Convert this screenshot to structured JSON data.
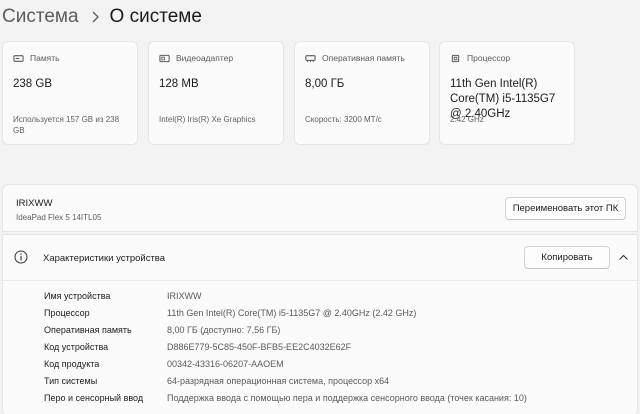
{
  "breadcrumb": {
    "parent": "Система",
    "current": "О системе"
  },
  "cards": [
    {
      "icon": "storage-icon",
      "label": "Память",
      "value": "238 GB",
      "sub": "Используется 157 GB из 238 GB"
    },
    {
      "icon": "graphics-card-icon",
      "label": "Видеоадаптер",
      "value": "128 MB",
      "sub": "Intel(R) Iris(R) Xe Graphics"
    },
    {
      "icon": "ram-icon",
      "label": "Оперативная память",
      "value": "8,00 ГБ",
      "sub": "Скорость: 3200 МТ/с"
    },
    {
      "icon": "processor-icon",
      "label": "Процессор",
      "value": "11th Gen Intel(R) Core(TM) i5-1135G7 @ 2.40GHz",
      "sub": "2.42 GHz"
    }
  ],
  "device": {
    "name": "IRIXWW",
    "model": "IdeaPad Flex 5 14ITL05",
    "rename_label": "Переименовать этот ПК"
  },
  "specs": {
    "icon": "info-icon",
    "title": "Характеристики устройства",
    "copy_label": "Копировать",
    "rows": [
      {
        "key": "Имя устройства",
        "value": "IRIXWW"
      },
      {
        "key": "Процессор",
        "value": "11th Gen Intel(R) Core(TM) i5-1135G7 @ 2.40GHz (2.42 GHz)"
      },
      {
        "key": "Оперативная память",
        "value": "8,00 ГБ (доступно: 7,56 ГБ)"
      },
      {
        "key": "Код устройства",
        "value": "D886E779-5C85-450F-BFB5-EE2C4032E62F"
      },
      {
        "key": "Код продукта",
        "value": "00342-43316-06207-AAOEM"
      },
      {
        "key": "Тип системы",
        "value": "64-разрядная операционная система, процессор x64"
      },
      {
        "key": "Перо и сенсорный ввод",
        "value": "Поддержка ввода с помощью пера и поддержка сенсорного ввода (точек касания: 10)"
      }
    ]
  }
}
